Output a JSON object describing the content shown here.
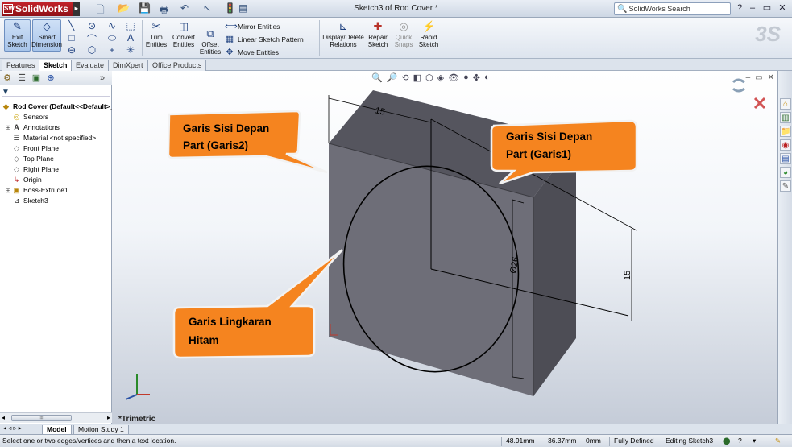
{
  "titlebar": {
    "app_name": "SolidWorks",
    "document_title": "Sketch3 of Rod Cover *",
    "search_placeholder": "SolidWorks Search",
    "minimize": "–",
    "restore": "▭",
    "close": "✕",
    "help": "?"
  },
  "ribbon": {
    "exit_sketch": "Exit Sketch",
    "smart_dimension": "Smart Dimension",
    "trim_entities": "Trim Entities",
    "convert_entities": "Convert Entities",
    "offset_entities": "Offset Entities",
    "mirror_entities": "Mirror Entities",
    "linear_sketch_pattern": "Linear Sketch Pattern",
    "move_entities": "Move Entities",
    "display_delete_relations": "Display/Delete Relations",
    "repair_sketch": "Repair Sketch",
    "quick_snaps": "Quick Snaps",
    "rapid_sketch": "Rapid Sketch"
  },
  "command_tabs": [
    "Features",
    "Sketch",
    "Evaluate",
    "DimXpert",
    "Office Products"
  ],
  "tree": {
    "root": "Rod Cover  (Default<<Default>_",
    "items": [
      "Sensors",
      "Annotations",
      "Material <not specified>",
      "Front Plane",
      "Top Plane",
      "Right Plane",
      "Origin",
      "Boss-Extrude1",
      "Sketch3"
    ]
  },
  "viewport": {
    "view_name": "*Trimetric",
    "dimension_top": "15",
    "dimension_diameter": "Ø26",
    "dimension_side": "15",
    "callout_front_garis2": "Garis Sisi  Depan Part (Garis2)",
    "callout_front_garis1": "Garis Sisi  Depan Part (Garis1)",
    "callout_circle": "Garis Lingkaran Hitam",
    "callout_color": "#f5841f",
    "part_face_color": "#6e6e78"
  },
  "model_tabs": [
    "Model",
    "Motion Study 1"
  ],
  "statusbar": {
    "message": "Select one or two edges/vertices and then a text location.",
    "x": "48.91mm",
    "y": "36.37mm",
    "z": "0mm",
    "state": "Fully Defined",
    "mode": "Editing Sketch3"
  }
}
